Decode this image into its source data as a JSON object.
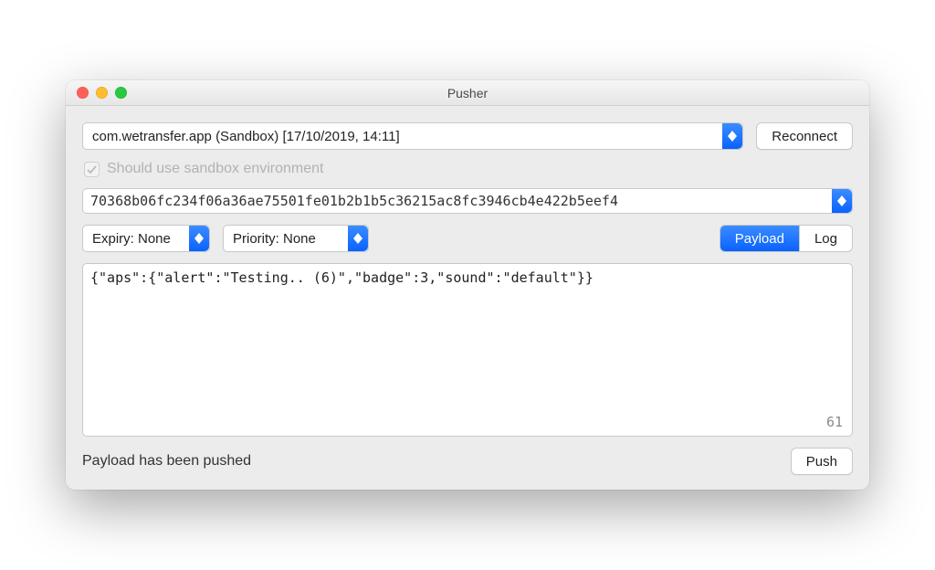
{
  "window": {
    "title": "Pusher"
  },
  "appSelect": {
    "value": "com.wetransfer.app (Sandbox)  [17/10/2019, 14:11]"
  },
  "reconnect": {
    "label": "Reconnect"
  },
  "sandboxCheckbox": {
    "label": "Should use sandbox environment",
    "checked": true
  },
  "deviceToken": {
    "value": "70368b06fc234f06a36ae75501fe01b2b1b5c36215ac8fc3946cb4e422b5eef4"
  },
  "expiry": {
    "value": "Expiry: None"
  },
  "priority": {
    "value": "Priority: None"
  },
  "tabs": {
    "payload": "Payload",
    "log": "Log",
    "active": "payload"
  },
  "payload": {
    "text": "{\"aps\":{\"alert\":\"Testing.. (6)\",\"badge\":3,\"sound\":\"default\"}}",
    "count": "61"
  },
  "status": {
    "text": "Payload has been pushed"
  },
  "push": {
    "label": "Push"
  }
}
